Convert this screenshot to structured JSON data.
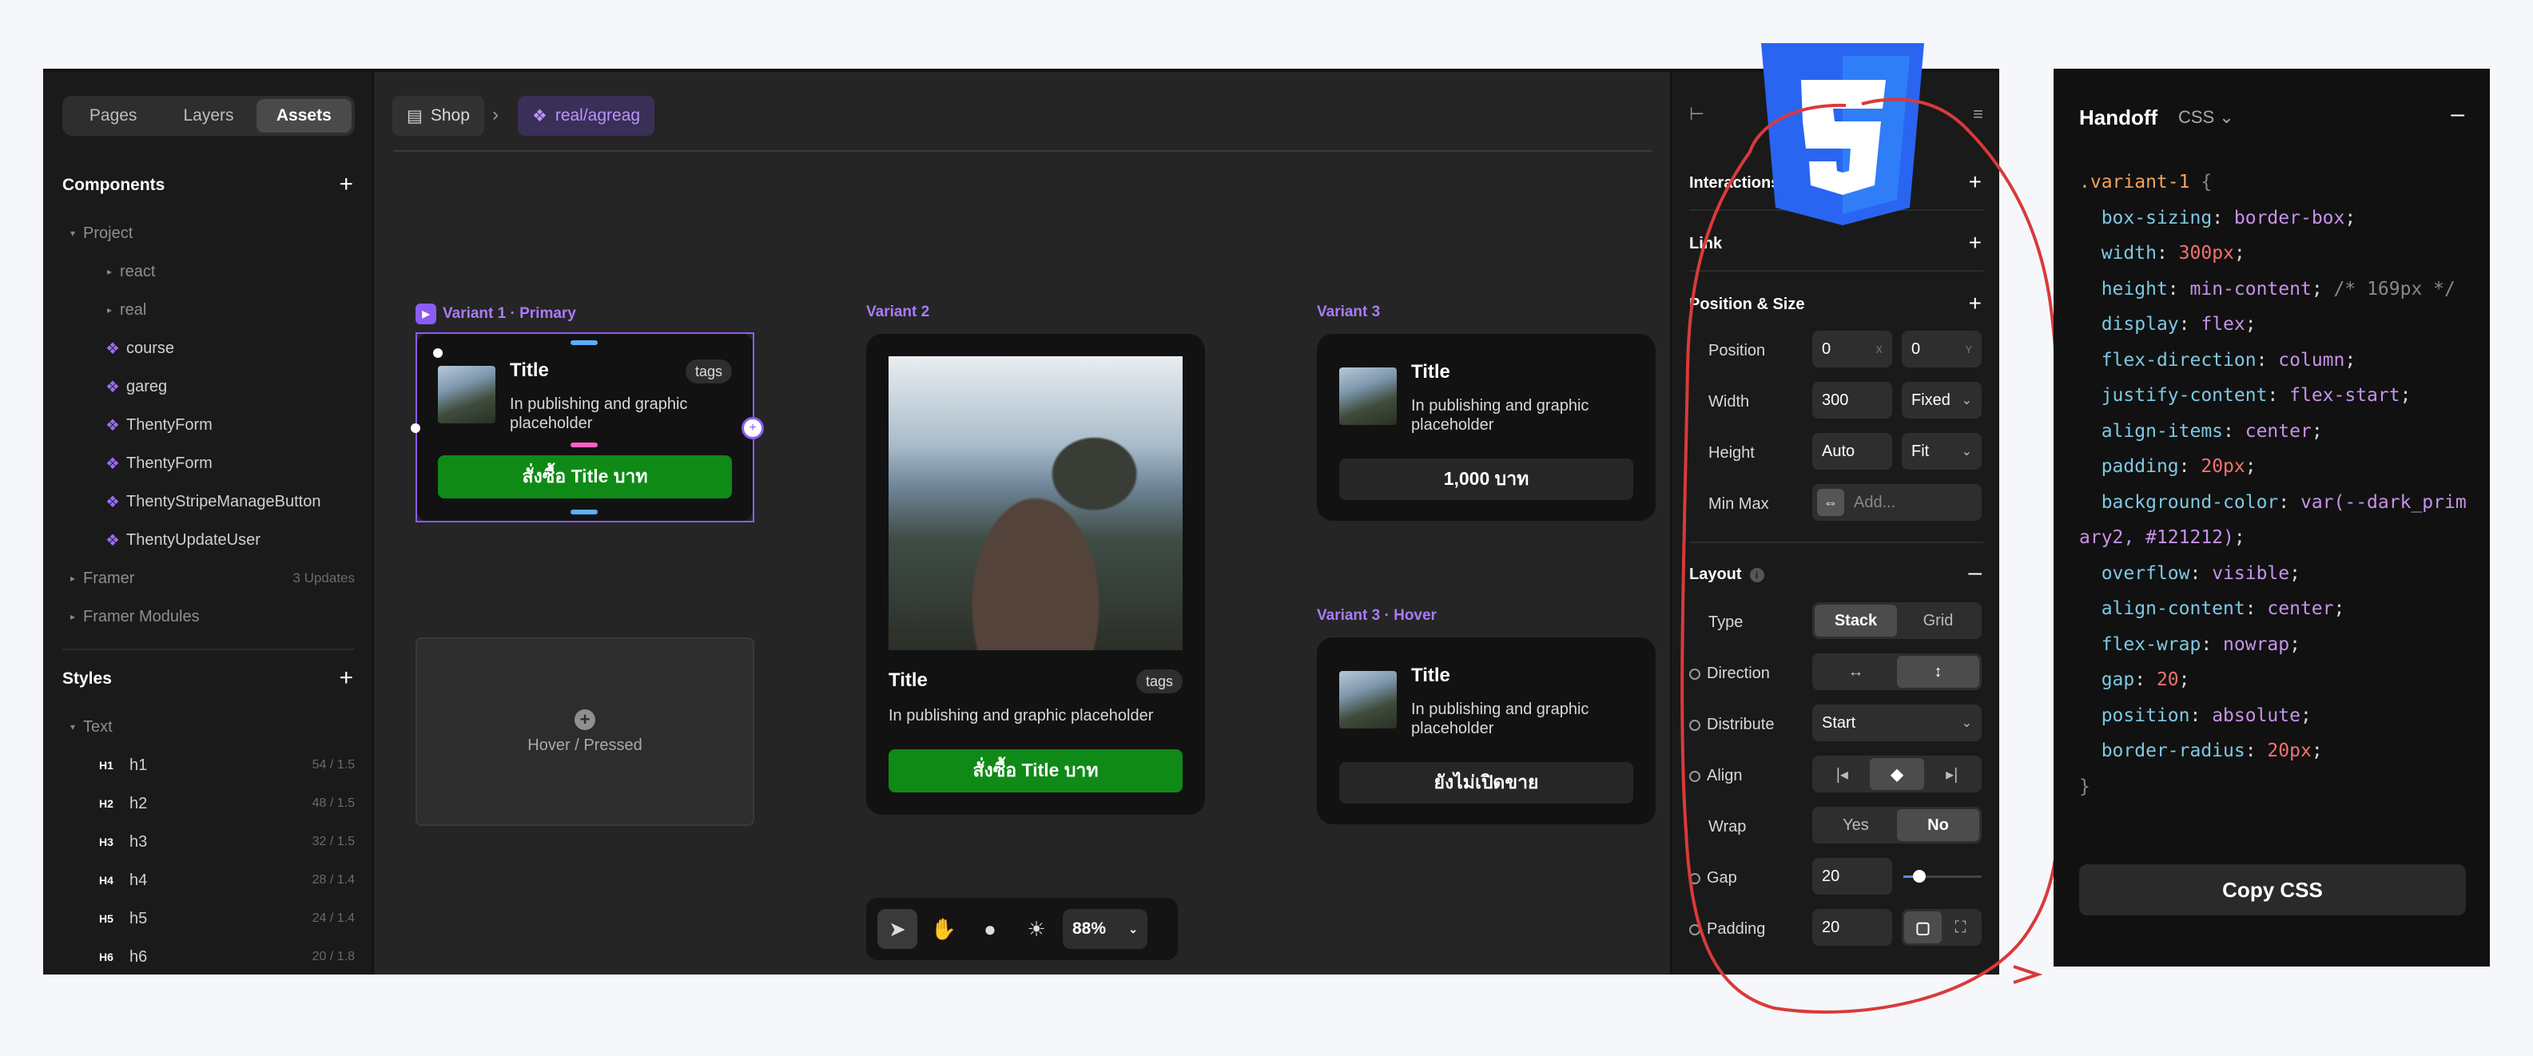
{
  "sidebar": {
    "tabs": [
      "Pages",
      "Layers",
      "Assets"
    ],
    "components_title": "Components",
    "tree": [
      {
        "label": "Project",
        "type": "folder"
      },
      {
        "label": "react",
        "type": "sub"
      },
      {
        "label": "real",
        "type": "sub"
      },
      {
        "label": "course",
        "type": "component"
      },
      {
        "label": "gareg",
        "type": "component"
      },
      {
        "label": "ThentyForm",
        "type": "component"
      },
      {
        "label": "ThentyForm",
        "type": "component"
      },
      {
        "label": "ThentyStripeManageButton",
        "type": "component"
      },
      {
        "label": "ThentyUpdateUser",
        "type": "component"
      },
      {
        "label": "Framer",
        "type": "folder",
        "note": "3 Updates"
      },
      {
        "label": "Framer Modules",
        "type": "folder"
      }
    ],
    "styles_title": "Styles",
    "text_group": "Text",
    "headings": [
      {
        "badge": "H1",
        "name": "h1",
        "meta": "54 / 1.5"
      },
      {
        "badge": "H2",
        "name": "h2",
        "meta": "48 / 1.5"
      },
      {
        "badge": "H3",
        "name": "h3",
        "meta": "32 / 1.5"
      },
      {
        "badge": "H4",
        "name": "h4",
        "meta": "28 / 1.4"
      },
      {
        "badge": "H5",
        "name": "h5",
        "meta": "24 / 1.4"
      },
      {
        "badge": "H6",
        "name": "h6",
        "meta": "20 / 1.8"
      }
    ]
  },
  "canvas": {
    "breadcrumb": [
      "Shop",
      "real/agreag"
    ],
    "variant1_label": "Variant 1 · Primary",
    "variant2_label": "Variant 2",
    "variant3_label": "Variant 3",
    "variant3h_label": "Variant 3 · Hover",
    "card_title": "Title",
    "card_desc": "In publishing and graphic placeholder",
    "tag": "tags",
    "buy_button": "สั่งซื้อ Title บาท",
    "price_button": "1,000 บาท",
    "not_open_button": "ยังไม่เปิดขาย",
    "hover_pressed": "Hover / Pressed",
    "zoom": "88%"
  },
  "props": {
    "interactions": "Interactions",
    "link": "Link",
    "position_size": "Position & Size",
    "position": "Position",
    "pos_x": "0",
    "pos_x_label": "X",
    "pos_y": "0",
    "pos_y_label": "Y",
    "width": "Width",
    "width_val": "300",
    "width_mode": "Fixed",
    "height": "Height",
    "height_val": "Auto",
    "height_mode": "Fit",
    "minmax": "Min Max",
    "minmax_placeholder": "Add...",
    "layout": "Layout",
    "type": "Type",
    "type_opts": [
      "Stack",
      "Grid"
    ],
    "direction": "Direction",
    "distribute": "Distribute",
    "distribute_val": "Start",
    "align": "Align",
    "wrap": "Wrap",
    "wrap_opts": [
      "Yes",
      "No"
    ],
    "gap": "Gap",
    "gap_val": "20",
    "gap_level": 0.2,
    "padding": "Padding",
    "padding_val": "20"
  },
  "handoff": {
    "title": "Handoff",
    "lang": "CSS",
    "copy": "Copy CSS"
  },
  "colors": {
    "accent": "#8b5cf6",
    "buy": "#0f8a17",
    "annotation": "#d93a3a",
    "css3_blue": "#2965f1"
  }
}
